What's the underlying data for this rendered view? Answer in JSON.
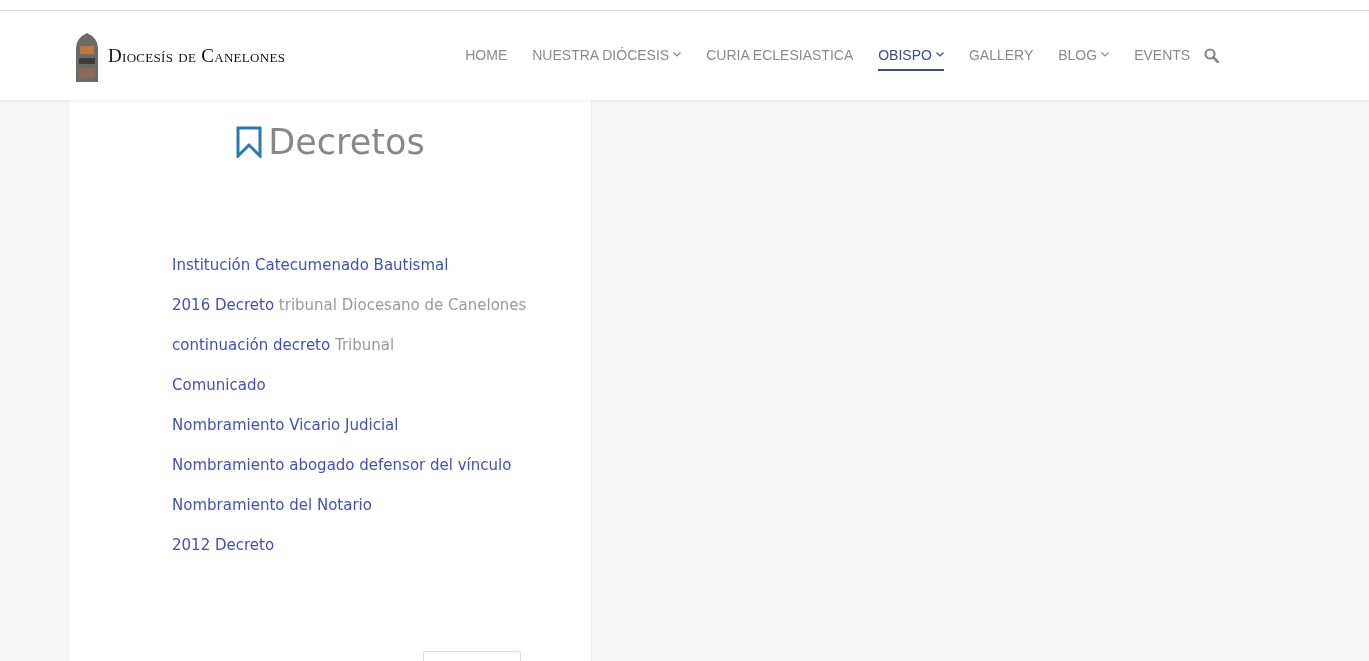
{
  "header": {
    "logo_text": "Diocesís de Canelones",
    "nav": [
      {
        "label": "HOME",
        "dropdown": false,
        "selected": false
      },
      {
        "label": "NUESTRA DIÓCESIS",
        "dropdown": true,
        "selected": false
      },
      {
        "label": "CURIA ECLESIASTICA",
        "dropdown": false,
        "selected": false
      },
      {
        "label": "OBISPO",
        "dropdown": true,
        "selected": true
      },
      {
        "label": "GALLERY",
        "dropdown": false,
        "selected": false
      },
      {
        "label": "BLOG",
        "dropdown": true,
        "selected": false
      },
      {
        "label": "EVENTS",
        "dropdown": false,
        "selected": false
      }
    ]
  },
  "panel": {
    "title": "Decretos",
    "items": [
      {
        "link": "Institución Catecumenado Bautismal"
      },
      {
        "link": "2016 Decreto",
        "rest": "tribunal Diocesano de Canelones"
      },
      {
        "link": "continuación decreto",
        "rest": "Tribunal"
      },
      {
        "link": "Comunicado"
      },
      {
        "link": "Nombramiento Vicario Judicial"
      },
      {
        "link": "Nombramiento abogado defensor del vínculo"
      },
      {
        "link": "Nombramiento del Notario"
      },
      {
        "link": "2012 Decreto"
      }
    ]
  }
}
